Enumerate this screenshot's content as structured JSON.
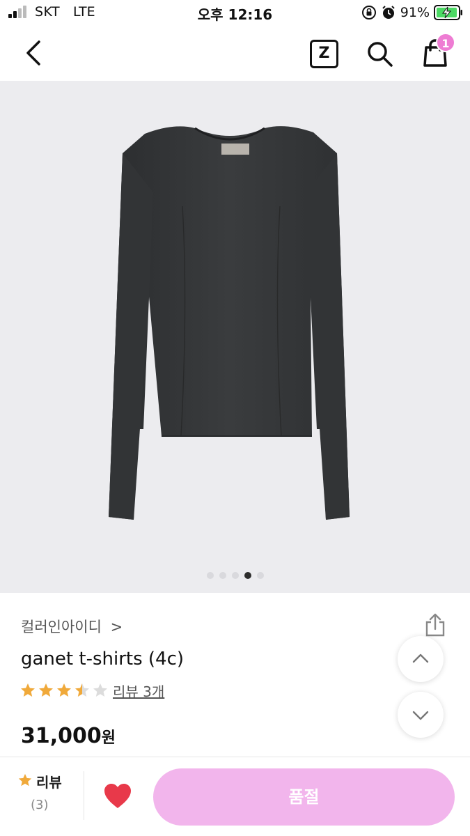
{
  "status_bar": {
    "carrier": "SKT",
    "network": "LTE",
    "time": "오후 12:16",
    "battery_percent": "91%",
    "icons": [
      "signal-icon",
      "orientation-lock-icon",
      "alarm-icon",
      "battery-charging-icon"
    ]
  },
  "nav": {
    "back_icon": "chevron-left-icon",
    "z_label": "Z",
    "search_icon": "search-icon",
    "cart_icon": "shopping-bag-icon",
    "cart_badge": "1",
    "badge_color": "#ee7cd3"
  },
  "gallery": {
    "image": "black long-sleeve t-shirt",
    "page_count": 5,
    "active_index": 3
  },
  "product": {
    "brand": "컬러인아이디",
    "brand_chevron": ">",
    "title": "ganet t-shirts (4c)",
    "rating": 3.5,
    "rating_max": 5,
    "review_link": "리뷰 3개",
    "price": "31,000",
    "price_unit": "원",
    "share_icon": "share-icon",
    "scroll_up_icon": "chevron-up-icon",
    "scroll_down_icon": "chevron-down-icon",
    "star_color": "#f0a93a"
  },
  "bottom_bar": {
    "review_label": "리뷰",
    "review_count": "(3)",
    "like_icon": "heart-icon",
    "like_color": "#e8394a",
    "action_label": "품절",
    "action_color": "#f2b5ec"
  }
}
